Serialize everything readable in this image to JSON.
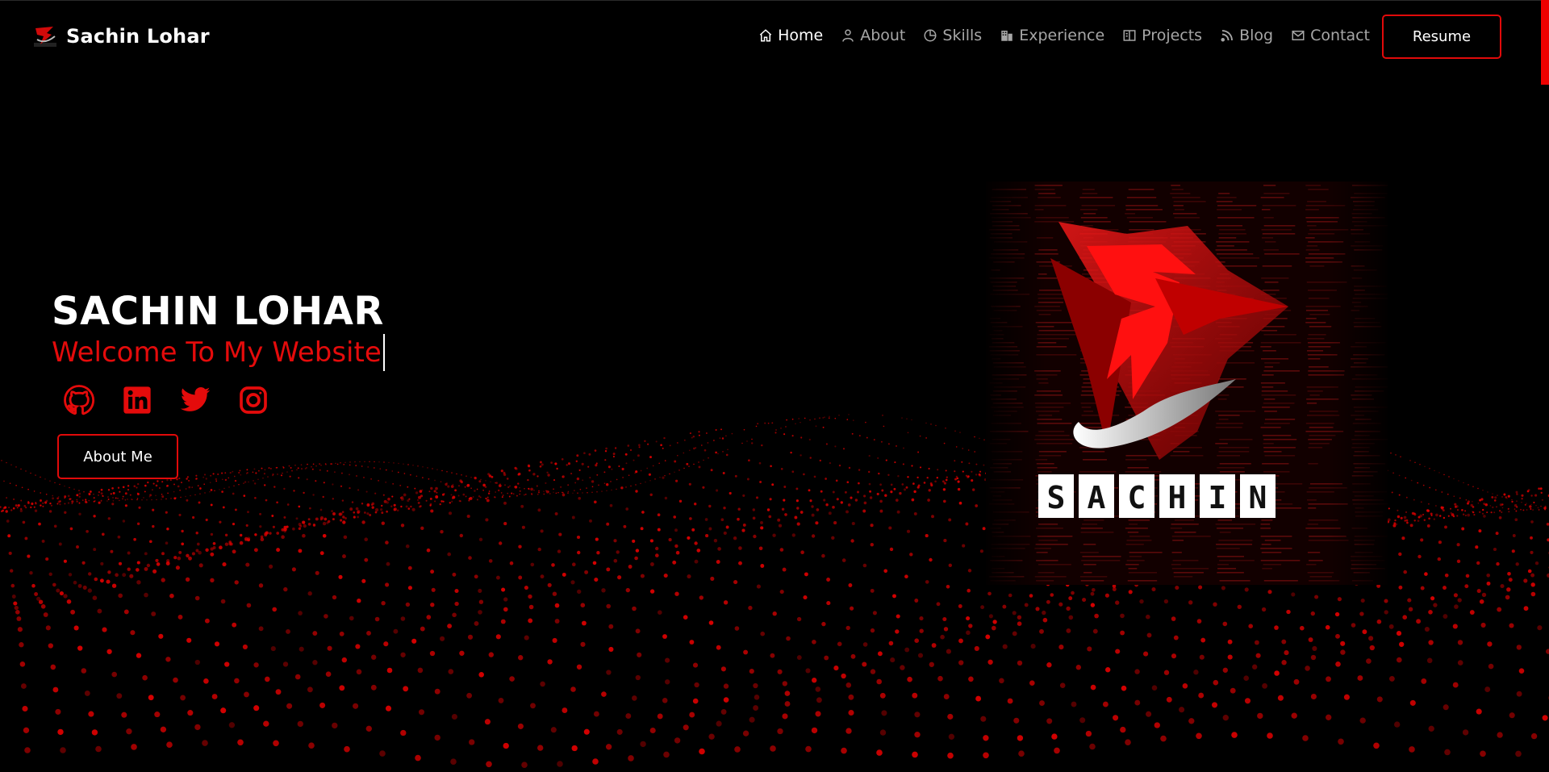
{
  "brand": {
    "name": "Sachin Lohar",
    "logo_icon": "sachin-s-logo-icon"
  },
  "nav": {
    "items": [
      {
        "label": "Home",
        "icon": "home-icon",
        "active": true
      },
      {
        "label": "About",
        "icon": "user-icon",
        "active": false
      },
      {
        "label": "Skills",
        "icon": "pie-chart-icon",
        "active": false
      },
      {
        "label": "Experience",
        "icon": "building-icon",
        "active": false
      },
      {
        "label": "Projects",
        "icon": "book-icon",
        "active": false
      },
      {
        "label": "Blog",
        "icon": "rss-icon",
        "active": false
      },
      {
        "label": "Contact",
        "icon": "mail-icon",
        "active": false
      }
    ],
    "resume_label": "Resume"
  },
  "hero": {
    "name": "SACHIN LOHAR",
    "tagline": "Welcome To My Website",
    "socials": [
      {
        "name": "github-icon"
      },
      {
        "name": "linkedin-icon"
      },
      {
        "name": "twitter-icon"
      },
      {
        "name": "instagram-icon"
      }
    ],
    "about_button": "About Me",
    "image_text": "SACHIN"
  },
  "colors": {
    "accent": "#e40b0b",
    "background": "#000000",
    "nav_text": "#a6a6a6",
    "text": "#ffffff"
  }
}
